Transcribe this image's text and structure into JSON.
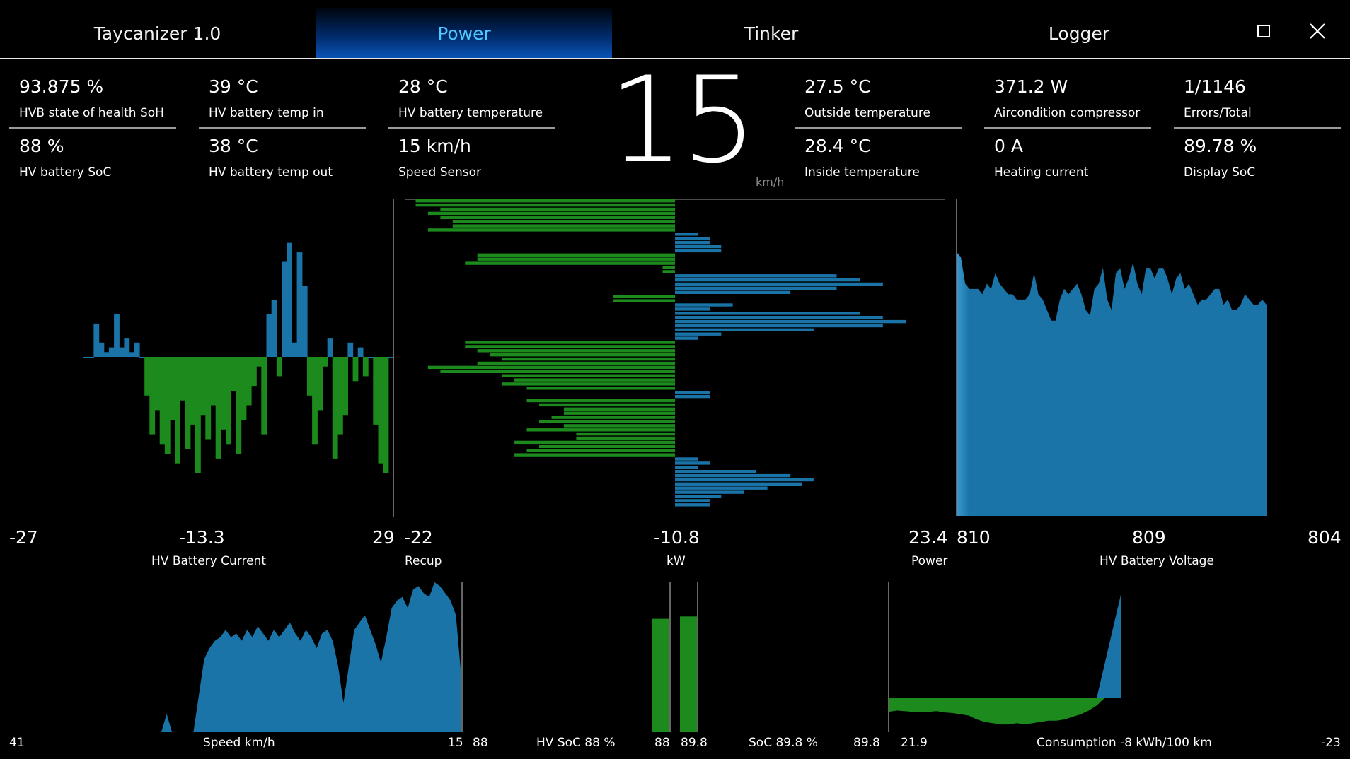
{
  "app": {
    "title": "Taycanizer 1.0",
    "tabs": [
      {
        "label": "Power",
        "active": true
      },
      {
        "label": "Tinker",
        "active": false
      },
      {
        "label": "Logger",
        "active": false
      }
    ],
    "maximize_icon": "square-outline-icon",
    "close_icon": "x-icon"
  },
  "colors": {
    "background": "#000000",
    "blue": "#1a74a8",
    "green": "#1c8a1c",
    "active_tab_text": "#4ec8ff"
  },
  "metrics": {
    "col1": [
      {
        "value": "93.875 %",
        "label": "HVB state of health SoH"
      },
      {
        "value": "88 %",
        "label": "HV battery SoC"
      }
    ],
    "col2": [
      {
        "value": "39 °C",
        "label": "HV battery temp in"
      },
      {
        "value": "38 °C",
        "label": "HV battery temp out"
      }
    ],
    "col3": [
      {
        "value": "28 °C",
        "label": "HV battery temperature"
      },
      {
        "value": "15 km/h",
        "label": "Speed Sensor"
      }
    ],
    "col4": [
      {
        "value": "27.5 °C",
        "label": "Outside temperature"
      },
      {
        "value": "28.4 °C",
        "label": "Inside temperature"
      }
    ],
    "col5": [
      {
        "value": "371.2 W",
        "label": "Aircondition compressor"
      },
      {
        "value": "0 A",
        "label": "Heating current"
      }
    ],
    "col6": [
      {
        "value": "1/1146",
        "label": "Errors/Total"
      },
      {
        "value": "89.78 %",
        "label": "Display SoC"
      }
    ]
  },
  "speed": {
    "value": "15",
    "unit": "km/h"
  },
  "charts": {
    "current": {
      "min": "-27",
      "mid": "-13.3",
      "max": "29",
      "label": "HV Battery Current"
    },
    "power": {
      "left": "-22",
      "mid": "-10.8",
      "right": "23.4",
      "left_label": "Recup",
      "mid_label": "kW",
      "right_label": "Power"
    },
    "voltage": {
      "left": "810",
      "mid": "809",
      "right": "804",
      "label": "HV Battery Voltage"
    },
    "speed": {
      "left": "41",
      "label": "Speed km/h",
      "right": "15"
    },
    "soc": {
      "left": "88",
      "label1": "HV SoC 88 %",
      "mid1": "88",
      "mid2": "89.8",
      "label2": "SoC 89.8 %",
      "right": "89.8"
    },
    "consumption": {
      "left": "21.9",
      "label": "Consumption -8 kWh/100 km",
      "right": "-23"
    }
  },
  "chart_data": [
    {
      "type": "area",
      "title": "HV Battery Current",
      "ylim": [
        -27,
        29
      ],
      "x": [
        0,
        10,
        20,
        30,
        40,
        50,
        60,
        70,
        80,
        90,
        100,
        110,
        120,
        130,
        140,
        150,
        160,
        170,
        180,
        190,
        200,
        210,
        220,
        230,
        240,
        250,
        260,
        270,
        280,
        290,
        300,
        310,
        320,
        330,
        340,
        350,
        360,
        370,
        380,
        390,
        400,
        410,
        420,
        430,
        440,
        450,
        460,
        470,
        480,
        490,
        500,
        510,
        520,
        530,
        540,
        550,
        560,
        570,
        580,
        590,
        600
      ],
      "values": [
        0,
        0,
        7,
        3,
        1,
        2,
        9,
        2,
        4,
        1,
        3,
        0,
        -8,
        -16,
        -11,
        -18,
        -20,
        -13,
        -22,
        -9,
        -19,
        -14,
        -24,
        -12,
        -17,
        -10,
        -21,
        -15,
        -18,
        -7,
        -20,
        -13,
        -10,
        -6,
        -2,
        -16,
        9,
        12,
        -4,
        20,
        24,
        3,
        22,
        15,
        -8,
        -18,
        -11,
        -2,
        4,
        -21,
        -16,
        -12,
        3,
        -5,
        2,
        -4,
        0,
        -14,
        -22,
        -24,
        0
      ]
    },
    {
      "type": "bar",
      "title": "Power",
      "orientation": "horizontal",
      "xlim": [
        -22,
        23.4
      ],
      "values": [
        -21,
        -21,
        -19,
        -20,
        -19,
        -18,
        -18,
        -20,
        2,
        3,
        3,
        4,
        4,
        -16,
        -16,
        -17,
        -1,
        -1,
        14,
        16,
        18,
        14,
        10,
        -5,
        -5,
        5,
        3,
        16,
        18,
        20,
        18,
        12,
        4,
        2,
        -17,
        -17,
        -16,
        -15,
        -14,
        -16,
        -20,
        -19,
        -14,
        -13,
        -14,
        -12,
        3,
        3,
        -12,
        -11,
        -9,
        -9,
        -10,
        -11,
        -9,
        -12,
        -8,
        -8,
        -13,
        -11,
        -12,
        -13,
        2,
        3,
        2,
        7,
        10,
        12,
        11,
        8,
        6,
        4,
        3,
        3
      ]
    },
    {
      "type": "area",
      "title": "HV Battery Voltage",
      "ylim": [
        804,
        810
      ],
      "values": [
        809.0,
        808.9,
        808.4,
        808.3,
        808.3,
        808.3,
        808.2,
        808.4,
        808.3,
        808.6,
        808.4,
        808.3,
        808.2,
        808.2,
        808.1,
        808.1,
        808.1,
        808.2,
        808.6,
        808.2,
        808.1,
        807.9,
        807.7,
        807.7,
        808.1,
        808.3,
        808.2,
        808.3,
        808.4,
        808.2,
        807.9,
        807.8,
        808.3,
        808.4,
        808.7,
        808.1,
        807.9,
        808.6,
        808.7,
        808.3,
        808.5,
        808.8,
        808.4,
        808.2,
        808.7,
        808.7,
        808.5,
        808.7,
        808.7,
        808.5,
        808.2,
        808.5,
        808.6,
        808.3,
        808.4,
        808.2,
        808.0,
        808.1,
        808.1,
        808.2,
        808.3,
        808.3,
        808.0,
        808.1,
        807.9,
        807.9,
        808.0,
        808.2,
        808.1,
        808.0,
        808.0,
        808.1,
        808.0
      ]
    },
    {
      "type": "area",
      "title": "Speed km/h",
      "ylim": [
        0,
        41
      ],
      "values": [
        0,
        5,
        0,
        0,
        0,
        0,
        0,
        10,
        20,
        23,
        25,
        26,
        28,
        26,
        27,
        25,
        28,
        26,
        29,
        27,
        25,
        28,
        26,
        28,
        30,
        27,
        25,
        28,
        26,
        23,
        27,
        28,
        25,
        18,
        8,
        18,
        28,
        30,
        32,
        28,
        24,
        19,
        26,
        34,
        36,
        37,
        34,
        39,
        40,
        38,
        37,
        41,
        40,
        38,
        36,
        32,
        15
      ]
    },
    {
      "type": "bar",
      "title": "SoC",
      "categories": [
        "HV SoC",
        "SoC"
      ],
      "values": [
        88,
        89.8
      ],
      "ylim": [
        0,
        100
      ]
    },
    {
      "type": "area",
      "title": "Consumption -8 kWh/100 km",
      "ylim": [
        -23,
        21.9
      ],
      "values": [
        -11,
        -10,
        -10.5,
        -11,
        -11,
        -11,
        -10.5,
        -11.5,
        -12,
        -13,
        -14,
        -17,
        -19,
        -20,
        -21,
        -21,
        -20,
        -21,
        -20,
        -19,
        -18,
        -18,
        -17,
        -15,
        -13,
        -10,
        -6,
        5,
        10,
        15
      ]
    }
  ]
}
